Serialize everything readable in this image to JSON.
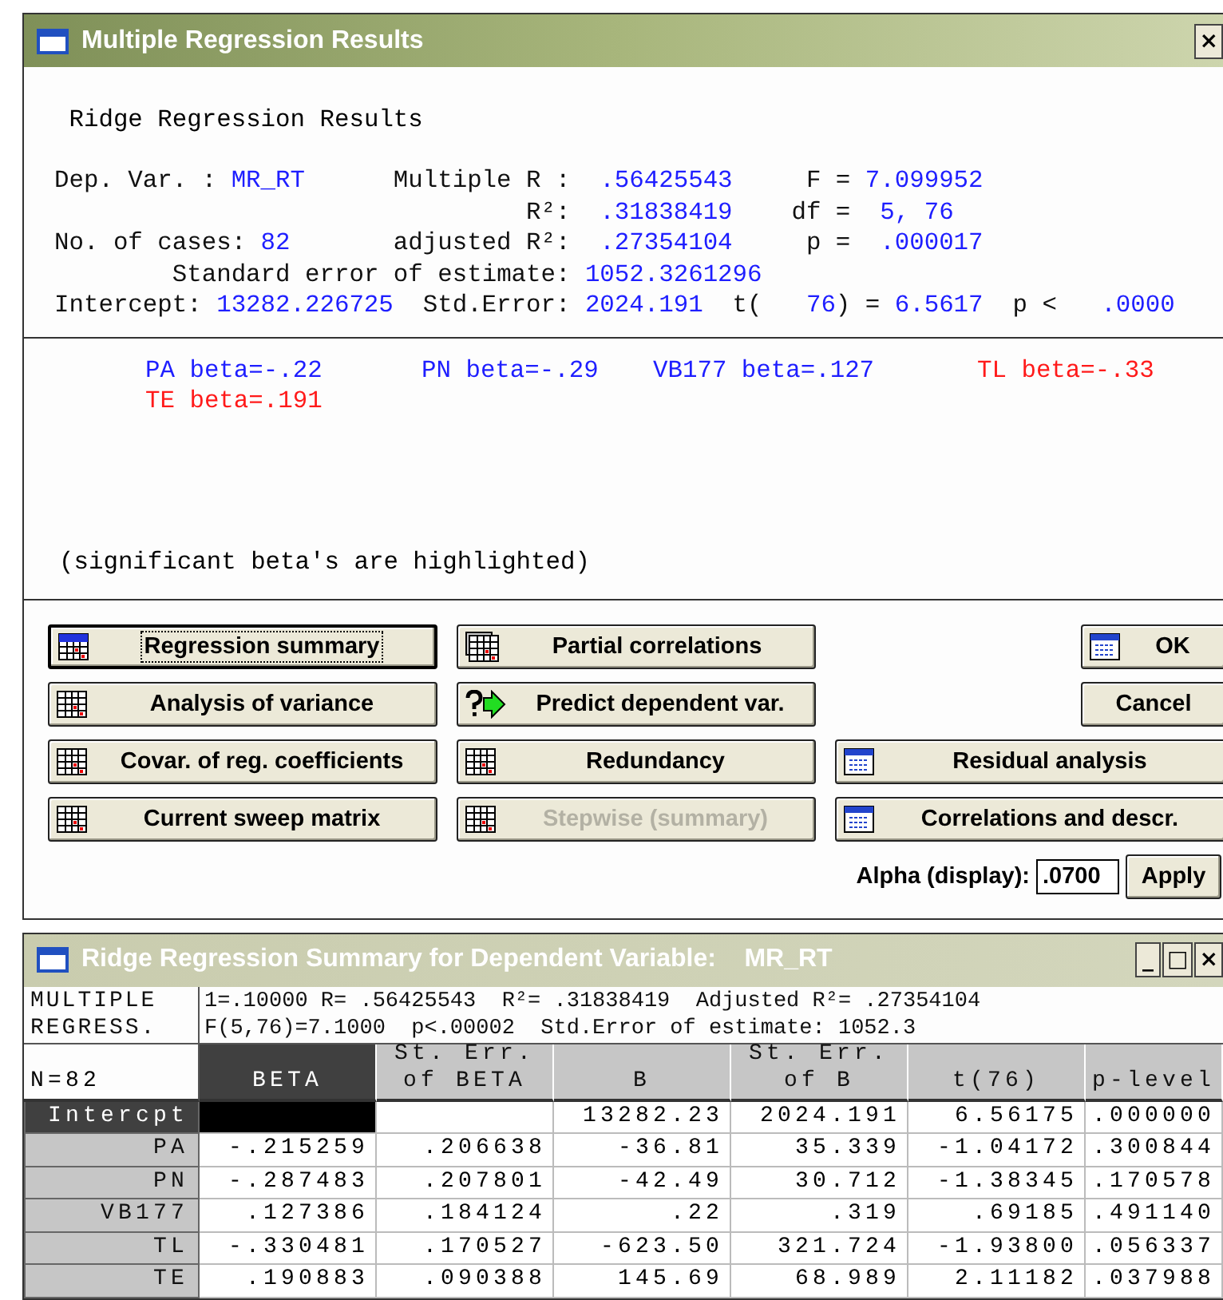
{
  "main_window": {
    "title": "Multiple Regression Results",
    "close": "×",
    "results": {
      "heading": "Ridge Regression Results",
      "lines": [
        [
          {
            "text": "Dep. Var. :",
            "kind": "label"
          },
          {
            "text": "MR_RT",
            "kind": "value"
          },
          {
            "text": "Multiple R :",
            "kind": "label"
          },
          {
            "text": ".56425543",
            "kind": "value"
          },
          {
            "text": "F =",
            "kind": "label"
          },
          {
            "text": "7.099952",
            "kind": "value"
          }
        ],
        [
          {
            "text": "R²:",
            "kind": "label"
          },
          {
            "text": ".31838419",
            "kind": "value"
          },
          {
            "text": "df =",
            "kind": "label"
          },
          {
            "text": "5, 76",
            "kind": "value"
          }
        ],
        [
          {
            "text": "No. of cases:",
            "kind": "label"
          },
          {
            "text": "82",
            "kind": "value"
          },
          {
            "text": "adjusted R²:",
            "kind": "label"
          },
          {
            "text": ".27354104",
            "kind": "value"
          },
          {
            "text": "p =",
            "kind": "label"
          },
          {
            "text": ".000017",
            "kind": "value"
          }
        ],
        [
          {
            "text": "Standard error of estimate:",
            "kind": "label"
          },
          {
            "text": "1052.3261296",
            "kind": "value"
          }
        ],
        [
          {
            "text": "Intercept:",
            "kind": "label"
          },
          {
            "text": "13282.226725",
            "kind": "value"
          },
          {
            "text": "Std.Error:",
            "kind": "label"
          },
          {
            "text": "2024.191",
            "kind": "value"
          },
          {
            "text": "t(",
            "kind": "label"
          },
          {
            "text": "76",
            "kind": "value"
          },
          {
            "text": ") =",
            "kind": "label"
          },
          {
            "text": "6.5617",
            "kind": "value"
          },
          {
            "text": "p <",
            "kind": "label"
          },
          {
            "text": ".0000",
            "kind": "value"
          }
        ]
      ]
    },
    "betas": [
      {
        "text": "PA beta=-.22",
        "highlighted": false
      },
      {
        "text": "PN beta=-.29",
        "highlighted": false
      },
      {
        "text": "VB177 beta=.127",
        "highlighted": false
      },
      {
        "text": "TL beta=-.33",
        "highlighted": true
      },
      {
        "text": "TE beta=.191",
        "highlighted": true
      }
    ],
    "note": "(significant beta's are highlighted)",
    "button_columns": [
      [
        {
          "label": "Regression summary",
          "focused": true,
          "disabled": false
        },
        {
          "label": "Analysis of variance",
          "focused": false,
          "disabled": false
        },
        {
          "label": "Covar. of reg. coefficients",
          "focused": false,
          "disabled": false
        },
        {
          "label": "Current sweep matrix",
          "focused": false,
          "disabled": false
        }
      ],
      [
        {
          "label": "Partial correlations",
          "focused": false,
          "disabled": false
        },
        {
          "label": "Predict dependent var.",
          "focused": false,
          "disabled": false
        },
        {
          "label": "Redundancy",
          "focused": false,
          "disabled": false
        },
        {
          "label": "Stepwise (summary)",
          "focused": false,
          "disabled": true
        }
      ],
      [
        {
          "label": "OK",
          "kind": "small",
          "focused": false,
          "disabled": false
        },
        {
          "label": "Cancel",
          "kind": "small",
          "focused": false,
          "disabled": false
        },
        {
          "label": "Residual analysis",
          "kind": "wide",
          "focused": false,
          "disabled": false
        },
        {
          "label": "Correlations and descr.",
          "kind": "wide",
          "focused": false,
          "disabled": false
        }
      ]
    ],
    "alpha": {
      "label": "Alpha (display):",
      "value": ".0700",
      "apply": "Apply"
    }
  },
  "summary_window": {
    "title": "Ridge Regression Summary for Dependent Variable:    MR_RT",
    "controls": [
      "_",
      "□",
      "×"
    ],
    "info_label": [
      "MULTIPLE",
      "REGRESS."
    ],
    "info_lines": [
      "1=.10000 R= .56425543  R²= .31838419  Adjusted R²= .27354104",
      "F(5,76)=7.1000  p<.00002  Std.Error of estimate: 1052.3"
    ],
    "corner": "N=82",
    "columns": [
      {
        "label": "BETA",
        "selected": true
      },
      {
        "label": "St. Err.\nof BETA",
        "selected": false
      },
      {
        "label": "B",
        "selected": false
      },
      {
        "label": "St. Err.\nof B",
        "selected": false
      },
      {
        "label": "t(76)",
        "selected": false
      },
      {
        "label": "p-level",
        "selected": false
      }
    ],
    "rows": [
      {
        "label": "Intercpt",
        "selected": true,
        "cells": [
          {
            "kind": "blocked"
          },
          null,
          "13282.23",
          "2024.191",
          "6.56175",
          ".000000"
        ]
      },
      {
        "label": "PA",
        "selected": false,
        "cells": [
          "-.215259",
          ".206638",
          "-36.81",
          "35.339",
          "-1.04172",
          ".300844"
        ]
      },
      {
        "label": "PN",
        "selected": false,
        "cells": [
          "-.287483",
          ".207801",
          "-42.49",
          "30.712",
          "-1.38345",
          ".170578"
        ]
      },
      {
        "label": "VB177",
        "selected": false,
        "cells": [
          ".127386",
          ".184124",
          ".22",
          ".319",
          ".69185",
          ".491140"
        ]
      },
      {
        "label": "TL",
        "selected": false,
        "cells": [
          "-.330481",
          ".170527",
          "-623.50",
          "321.724",
          "-1.93800",
          ".056337"
        ]
      },
      {
        "label": "TE",
        "selected": false,
        "cells": [
          ".190883",
          ".090388",
          "145.69",
          "68.989",
          "2.11182",
          ".037988"
        ]
      }
    ]
  }
}
